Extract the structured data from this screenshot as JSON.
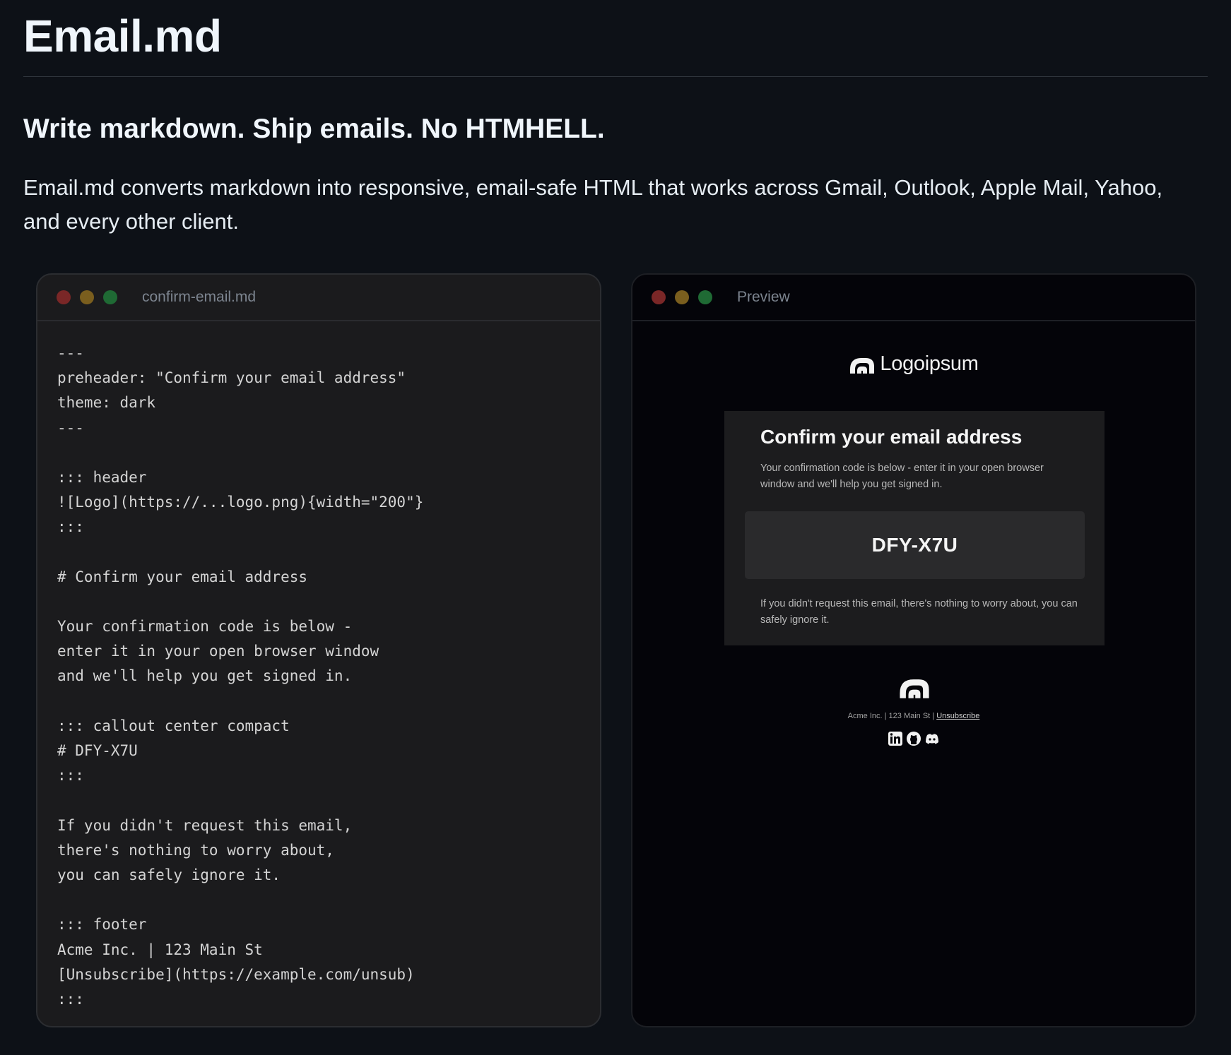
{
  "page": {
    "title": "Email.md",
    "tagline": "Write markdown. Ship emails. No HTMHELL.",
    "intro": "Email.md converts markdown into responsive, email-safe HTML that works across Gmail, Outlook, Apple Mail, Yahoo, and every other client."
  },
  "editor": {
    "title": "confirm-email.md",
    "lines": [
      "---",
      "preheader: \"Confirm your email address\"",
      "theme: dark",
      "---",
      "",
      "::: header",
      "![Logo](https://...logo.png){width=\"200\"}",
      ":::",
      "",
      "# Confirm your email address",
      "",
      "Your confirmation code is below -",
      "enter it in your open browser window",
      "and we'll help you get signed in.",
      "",
      "::: callout center compact",
      "# DFY-X7U",
      ":::",
      "",
      "If you didn't request this email,",
      "there's nothing to worry about,",
      "you can safely ignore it.",
      "",
      "::: footer",
      "Acme Inc. | 123 Main St",
      "[Unsubscribe](https://example.com/unsub)",
      ":::"
    ]
  },
  "preview": {
    "title": "Preview",
    "logo_text": "Logoipsum",
    "heading": "Confirm your email address",
    "body": "Your confirmation code is below - enter it in your open browser window and we'll help you get signed in.",
    "code": "DFY-X7U",
    "note": "If you didn't request this email, there's nothing to worry about, you can safely ignore it.",
    "footer_address": "Acme Inc. | 123 Main St | ",
    "unsubscribe": "Unsubscribe",
    "social_icons": [
      "linkedin-icon",
      "github-icon",
      "discord-icon"
    ]
  },
  "colors": {
    "background": "#0d1117",
    "editor_bg": "#1b1b1d",
    "preview_bg": "#040409",
    "card_bg": "#1c1c1e",
    "dot_red": "#7a2727",
    "dot_yellow": "#7a5e1e",
    "dot_green": "#1f6a34"
  }
}
